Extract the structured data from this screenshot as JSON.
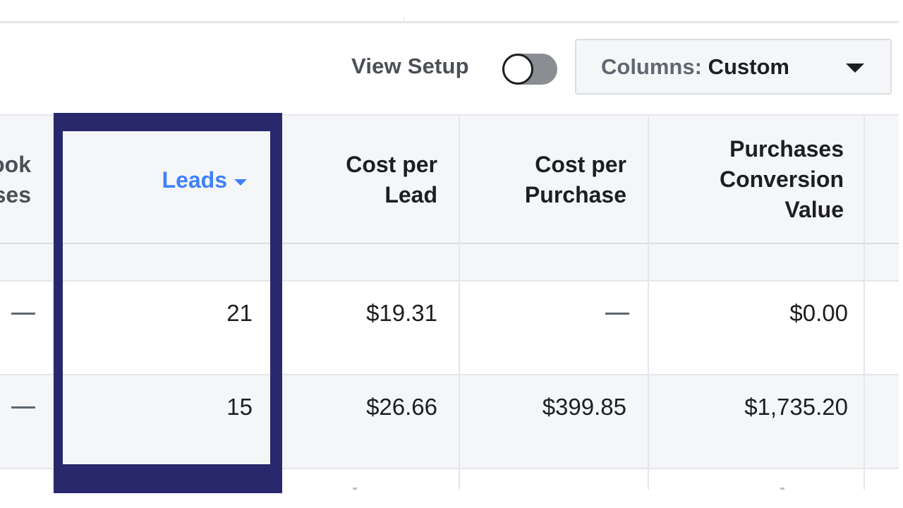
{
  "toolbar": {
    "view_setup_label": "View Setup",
    "view_setup_toggle_on": false,
    "columns_prefix": "Columns: ",
    "columns_value": "Custom"
  },
  "table": {
    "columns": [
      {
        "id": "partial",
        "label_lines": [
          "ook",
          "ses"
        ]
      },
      {
        "id": "leads",
        "label": "Leads",
        "sorted": "descending"
      },
      {
        "id": "cost_per_lead",
        "label_lines": [
          "Cost per",
          "Lead"
        ]
      },
      {
        "id": "cost_per_purchase",
        "label_lines": [
          "Cost per",
          "Purchase"
        ]
      },
      {
        "id": "purchases_conversion_value",
        "label_lines": [
          "Purchases",
          "Conversion",
          "Value"
        ]
      }
    ],
    "rows": [
      {
        "partial": "—",
        "leads": "21",
        "cost_per_lead": "$19.31",
        "cost_per_purchase": "—",
        "purchases_conversion_value": "$0.00"
      },
      {
        "partial": "—",
        "leads": "15",
        "cost_per_lead": "$26.66",
        "cost_per_purchase": "$399.85",
        "purchases_conversion_value": "$1,735.20"
      }
    ]
  },
  "colors": {
    "highlight_border": "#29286d",
    "sorted_header": "#4080ff",
    "header_bg": "#f5f6f7"
  }
}
